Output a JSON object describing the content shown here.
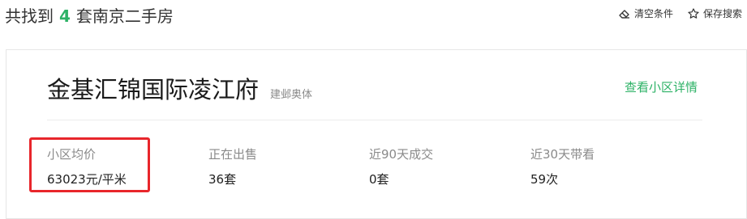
{
  "header": {
    "result_prefix": "共找到",
    "result_count": "4",
    "result_suffix": "套南京二手房",
    "actions": [
      {
        "label": "清空条件",
        "icon": "eraser-icon"
      },
      {
        "label": "保存搜索",
        "icon": "star-icon"
      }
    ]
  },
  "community": {
    "name": "金基汇锦国际凌江府",
    "district": "建邺奥体",
    "detail_link": "查看小区详情",
    "stats": [
      {
        "label": "小区均价",
        "value": "63023元/平米"
      },
      {
        "label": "正在出售",
        "value": "36套"
      },
      {
        "label": "近90天成交",
        "value": "0套"
      },
      {
        "label": "近30天带看",
        "value": "59次"
      }
    ]
  },
  "colors": {
    "accent": "#2db266",
    "highlight": "#e8262b"
  }
}
